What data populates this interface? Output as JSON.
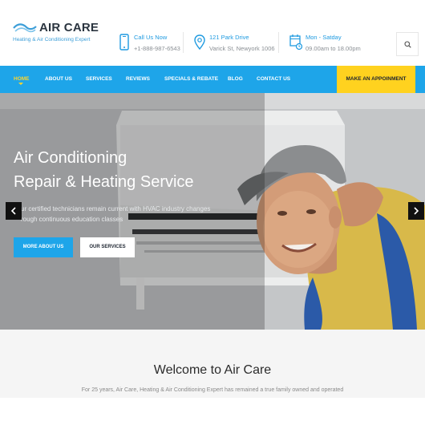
{
  "brand": {
    "name": "AIR CARE",
    "tagline": "Heating & Air Conditioning Expert",
    "logo_icon": "wave-logo-icon"
  },
  "header_info": [
    {
      "icon": "phone-icon",
      "title": "Call Us Now",
      "text": "+1-888-987-6543"
    },
    {
      "icon": "location-pin-icon",
      "title": "121 Park Drive",
      "text": "Varick St, Newyork 1006"
    },
    {
      "icon": "calendar-clock-icon",
      "title": "Mon - Satday",
      "text": "09.00am to 18.00pm"
    }
  ],
  "search": {
    "icon": "search-icon"
  },
  "nav": {
    "items": [
      {
        "label": "HOME",
        "active": true
      },
      {
        "label": "ABOUT US",
        "active": false
      },
      {
        "label": "SERVICES",
        "active": false
      },
      {
        "label": "REVIEWS",
        "active": false
      },
      {
        "label": "SPECIALS & REBATE",
        "active": false
      },
      {
        "label": "BLOG",
        "active": false
      },
      {
        "label": "CONTACT US",
        "active": false
      }
    ],
    "cta": "MAKE AN APPOINMENT"
  },
  "hero": {
    "title_line1": "Air Conditioning",
    "title_line2": "Repair & Heating Service",
    "desc_line1": "ur certified technicians remain current with HVAC industry changes",
    "desc_line2": "rough continuous education classes",
    "button_primary": "MORE ABOUT US",
    "button_secondary": "OUR SERVICES",
    "prev_icon": "chevron-left-icon",
    "next_icon": "chevron-right-icon"
  },
  "welcome": {
    "title": "Welcome to Air Care",
    "text": "For 25 years, Air Care, Heating & Air Conditioning Expert has remained a true family owned and operated"
  },
  "colors": {
    "primary": "#1ea5e9",
    "accent": "#ffd21f",
    "dark": "#2b3540"
  }
}
